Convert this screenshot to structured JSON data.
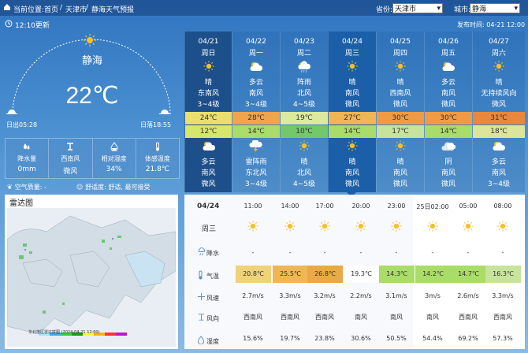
{
  "topbar": {
    "location_label": "当前位置:",
    "crumb_home": "首页",
    "crumb_city": "天津市",
    "crumb_page": "静海天气预报",
    "province_label": "省份:",
    "province_value": "天津市",
    "city_label": "城市:",
    "city_value": "静海"
  },
  "update_time": "12:10更新",
  "publish_time": "发布时间: 04-21 12:00",
  "current": {
    "city": "静海",
    "temp": "22℃",
    "sunrise": "日出05:28",
    "sunset": "日落18:55"
  },
  "stats": [
    {
      "label": "降水量",
      "value": "0mm",
      "icon": "raindrop-icon"
    },
    {
      "label": "西南风",
      "value": "微风",
      "icon": "wind-icon"
    },
    {
      "label": "相对湿度",
      "value": "34%",
      "icon": "humidity-icon"
    },
    {
      "label": "体感温度",
      "value": "21.8℃",
      "icon": "thermometer-icon"
    }
  ],
  "air_quality_label": "空气质量: -",
  "comfort_label": "舒适度: 舒适, 最可接受",
  "radar_title": "雷达图",
  "radar_caption": "华北地区雷达拼图 (2024-04-21 12:00)",
  "days": [
    {
      "date": "04/21",
      "week": "周日",
      "day_weather": "晴",
      "day_wind": "东南风",
      "day_wind_lv": "3~4级",
      "hi": "24℃",
      "hi_color": "#e9de6e",
      "lo": "12℃",
      "lo_color": "#d6e76b",
      "night_weather": "多云",
      "night_wind": "南风",
      "night_wind_lv": "微风",
      "day_icon": "sun",
      "night_icon": "cloud"
    },
    {
      "date": "04/22",
      "week": "周一",
      "day_weather": "多云",
      "day_wind": "南风",
      "day_wind_lv": "3~4级",
      "hi": "28℃",
      "hi_color": "#f0a44c",
      "lo": "14℃",
      "lo_color": "#a9dc68",
      "night_weather": "雷阵雨",
      "night_wind": "东北风",
      "night_wind_lv": "3~4级",
      "day_icon": "cloud",
      "night_icon": "storm"
    },
    {
      "date": "04/23",
      "week": "周二",
      "day_weather": "阵雨",
      "day_wind": "北风",
      "day_wind_lv": "4~5级",
      "hi": "19℃",
      "hi_color": "#dbea9c",
      "lo": "10℃",
      "lo_color": "#74c86a",
      "night_weather": "晴",
      "night_wind": "北风",
      "night_wind_lv": "4~5级",
      "day_icon": "rain",
      "night_icon": "sun"
    },
    {
      "date": "04/24",
      "week": "周三",
      "day_weather": "晴",
      "day_wind": "南风",
      "day_wind_lv": "微风",
      "hi": "27℃",
      "hi_color": "#efb655",
      "lo": "14℃",
      "lo_color": "#a9dc68",
      "night_weather": "晴",
      "night_wind": "南风",
      "night_wind_lv": "微风",
      "day_icon": "sun",
      "night_icon": "sun"
    },
    {
      "date": "04/25",
      "week": "周四",
      "day_weather": "晴",
      "day_wind": "西南风",
      "day_wind_lv": "微风",
      "hi": "30℃",
      "hi_color": "#f19a45",
      "lo": "17℃",
      "lo_color": "#c7e39c",
      "night_weather": "晴",
      "night_wind": "南风",
      "night_wind_lv": "微风",
      "day_icon": "sun",
      "night_icon": "sun"
    },
    {
      "date": "04/26",
      "week": "周五",
      "day_weather": "多云",
      "day_wind": "南风",
      "day_wind_lv": "微风",
      "hi": "30℃",
      "hi_color": "#f19a45",
      "lo": "14℃",
      "lo_color": "#a9dc68",
      "night_weather": "阴",
      "night_wind": "南风",
      "night_wind_lv": "微风",
      "day_icon": "cloud",
      "night_icon": "overcast"
    },
    {
      "date": "04/27",
      "week": "周六",
      "day_weather": "晴",
      "day_wind": "无持续风向",
      "day_wind_lv": "微风",
      "hi": "31℃",
      "hi_color": "#e9883d",
      "lo": "18℃",
      "lo_color": "#dce59a",
      "night_weather": "多云",
      "night_wind": "南风",
      "night_wind_lv": "3~4级",
      "day_icon": "sun",
      "night_icon": "cloud"
    }
  ],
  "hourly": {
    "date": "04/24",
    "week": "周三",
    "labels": {
      "rain": "降水",
      "temp": "气温",
      "wind_speed": "风速",
      "wind_dir": "风向",
      "humidity": "湿度"
    },
    "times": [
      "11:00",
      "14:00",
      "17:00",
      "20:00",
      "23:00",
      "25日02:00",
      "05:00",
      "08:00"
    ],
    "rain": [
      "-",
      "-",
      "-",
      "-",
      "-",
      "-",
      "-",
      "-"
    ],
    "temps": [
      "20.8℃",
      "25.5℃",
      "26.8℃",
      "19.3℃",
      "14.3℃",
      "14.2℃",
      "14.7℃",
      "16.3℃"
    ],
    "temp_colors": [
      "#efd27a",
      "#efb655",
      "#e9a948",
      "#ffffff",
      "#a9dc68",
      "#a9dc68",
      "#a9dc68",
      "#c7e39c"
    ],
    "wind_speeds": [
      "2.7m/s",
      "3.3m/s",
      "3.2m/s",
      "2.2m/s",
      "3.1m/s",
      "3m/s",
      "2.6m/s",
      "3.3m/s"
    ],
    "wind_dirs": [
      "西南风",
      "西南风",
      "西南风",
      "南风",
      "南风",
      "南风",
      "西南风",
      "西南风"
    ],
    "humidity": [
      "15.6%",
      "19.7%",
      "23.8%",
      "30.6%",
      "50.5%",
      "54.4%",
      "69.2%",
      "57.3%"
    ]
  }
}
